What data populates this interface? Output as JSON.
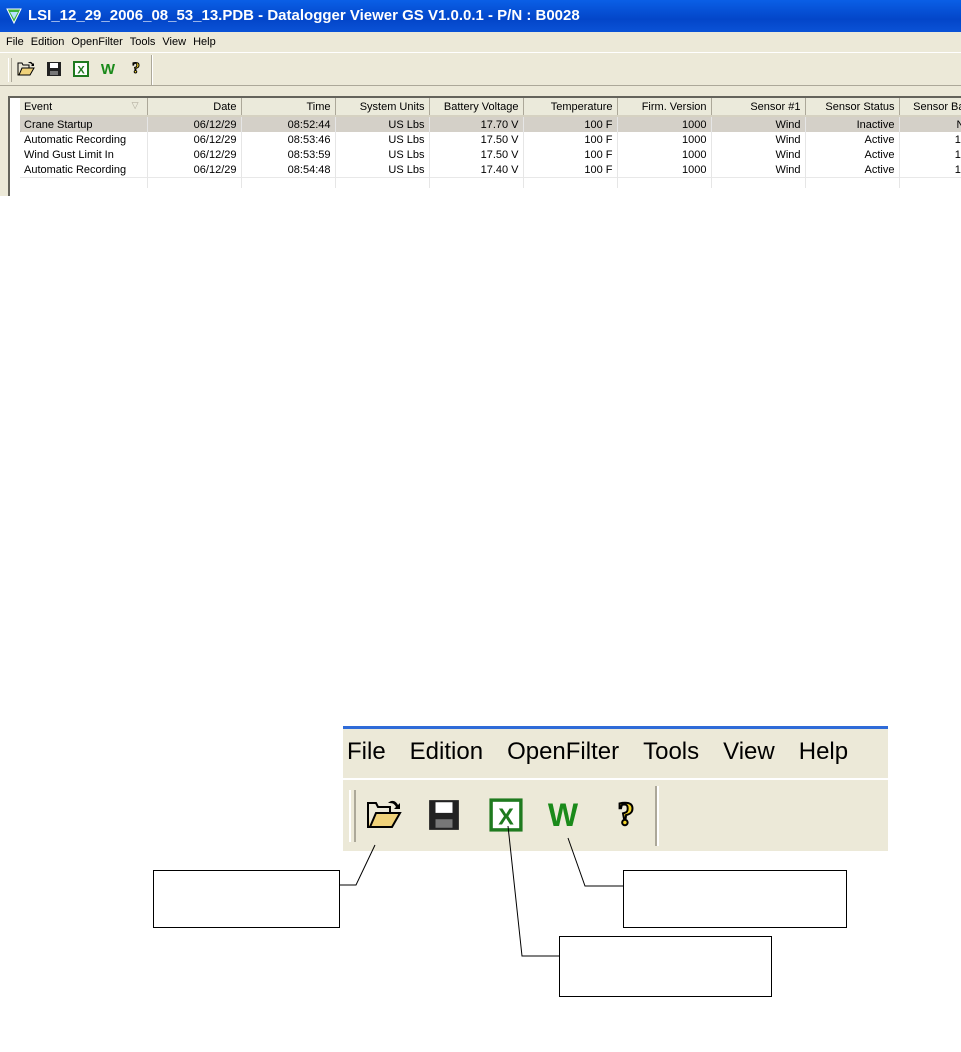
{
  "window": {
    "title": "LSI_12_29_2006_08_53_13.PDB - Datalogger Viewer GS V1.0.0.1 - P/N : B0028"
  },
  "menu": {
    "items": [
      "File",
      "Edition",
      "OpenFilter",
      "Tools",
      "View",
      "Help"
    ]
  },
  "toolbar": {
    "buttons": [
      {
        "icon": "open-folder-icon",
        "glyph": ""
      },
      {
        "icon": "save-disk-icon",
        "glyph": ""
      },
      {
        "icon": "excel-export-icon",
        "glyph": "X"
      },
      {
        "icon": "word-export-icon",
        "glyph": "W"
      },
      {
        "icon": "help-icon",
        "glyph": "?"
      }
    ]
  },
  "table": {
    "columns": [
      "Event",
      "Date",
      "Time",
      "System Units",
      "Battery Voltage",
      "Temperature",
      "Firm. Version",
      "Sensor #1",
      "Sensor Status",
      "Sensor Ba"
    ],
    "rows": [
      [
        "Crane Startup",
        "06/12/29",
        "08:52:44",
        "US Lbs",
        "17.70 V",
        "100 F",
        "1000",
        "Wind",
        "Inactive",
        "N"
      ],
      [
        "Automatic Recording",
        "06/12/29",
        "08:53:46",
        "US Lbs",
        "17.50 V",
        "100 F",
        "1000",
        "Wind",
        "Active",
        "1("
      ],
      [
        "Wind Gust Limit In",
        "06/12/29",
        "08:53:59",
        "US Lbs",
        "17.50 V",
        "100 F",
        "1000",
        "Wind",
        "Active",
        "1("
      ],
      [
        "Automatic Recording",
        "06/12/29",
        "08:54:48",
        "US Lbs",
        "17.40 V",
        "100 F",
        "1000",
        "Wind",
        "Active",
        "1("
      ]
    ],
    "selected_row": 0
  },
  "colors": {
    "titlebar": "#0346c9",
    "excel_green": "#1f7a1f",
    "word_green": "#1a8a1a",
    "help_yellow": "#f3d52a"
  }
}
